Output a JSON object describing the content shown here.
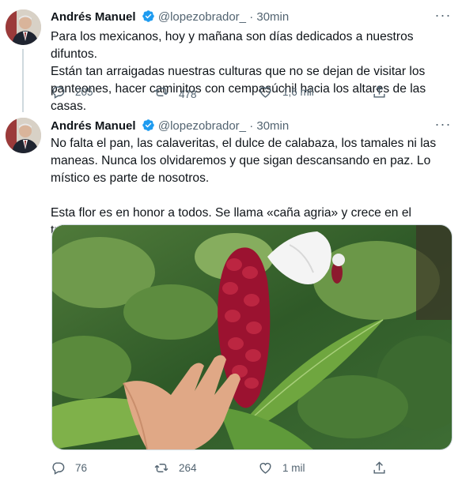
{
  "tweets": [
    {
      "author_name": "Andrés Manuel",
      "handle": "@lopezobrador_",
      "separator": "·",
      "time": "30min",
      "text": "Para los mexicanos, hoy y mañana son días dedicados a nuestros difuntos.\nEstán tan arraigadas nuestras culturas que no se dejan de visitar los\npanteones, hacer caminitos con cempasúchil hacia los altares de las casas.",
      "replies": "205",
      "retweets": "478",
      "likes": "1,6 mil"
    },
    {
      "author_name": "Andrés Manuel",
      "handle": "@lopezobrador_",
      "separator": "·",
      "time": "30min",
      "text": "No falta el pan, las calaveritas, el dulce de calabaza, los tamales ni las\nmaneas. Nunca los olvidaremos y que sigan descansando en paz. Lo\nmístico es parte de nosotros.\n\nEsta flor es en honor a todos. Se llama «caña agria» y crece en el trópico.",
      "replies": "76",
      "retweets": "264",
      "likes": "1 mil"
    }
  ],
  "icons": {
    "verified": "verified-badge-icon",
    "more": "more-options-icon",
    "reply": "reply-icon",
    "retweet": "retweet-icon",
    "like": "heart-icon",
    "share": "share-icon"
  },
  "colors": {
    "verified": "#1d9bf0",
    "secondary_text": "#536471",
    "thread_line": "#cfd9de"
  }
}
